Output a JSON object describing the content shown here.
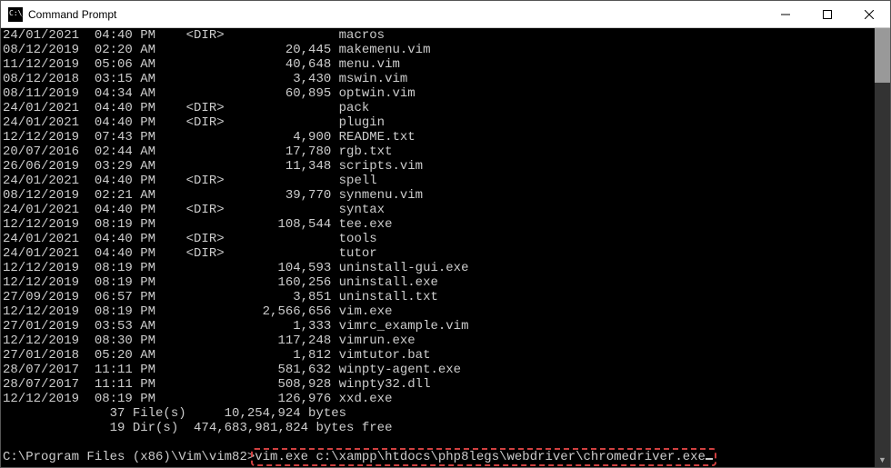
{
  "window": {
    "title": "Command Prompt"
  },
  "listing": [
    {
      "date": "24/01/2021",
      "time": "04:40 PM",
      "dir": true,
      "size": "",
      "name": "macros"
    },
    {
      "date": "08/12/2019",
      "time": "02:20 AM",
      "dir": false,
      "size": "20,445",
      "name": "makemenu.vim"
    },
    {
      "date": "11/12/2019",
      "time": "05:06 AM",
      "dir": false,
      "size": "40,648",
      "name": "menu.vim"
    },
    {
      "date": "08/12/2018",
      "time": "03:15 AM",
      "dir": false,
      "size": "3,430",
      "name": "mswin.vim"
    },
    {
      "date": "08/11/2019",
      "time": "04:34 AM",
      "dir": false,
      "size": "60,895",
      "name": "optwin.vim"
    },
    {
      "date": "24/01/2021",
      "time": "04:40 PM",
      "dir": true,
      "size": "",
      "name": "pack"
    },
    {
      "date": "24/01/2021",
      "time": "04:40 PM",
      "dir": true,
      "size": "",
      "name": "plugin"
    },
    {
      "date": "12/12/2019",
      "time": "07:43 PM",
      "dir": false,
      "size": "4,900",
      "name": "README.txt"
    },
    {
      "date": "20/07/2016",
      "time": "02:44 AM",
      "dir": false,
      "size": "17,780",
      "name": "rgb.txt"
    },
    {
      "date": "26/06/2019",
      "time": "03:29 AM",
      "dir": false,
      "size": "11,348",
      "name": "scripts.vim"
    },
    {
      "date": "24/01/2021",
      "time": "04:40 PM",
      "dir": true,
      "size": "",
      "name": "spell"
    },
    {
      "date": "08/12/2019",
      "time": "02:21 AM",
      "dir": false,
      "size": "39,770",
      "name": "synmenu.vim"
    },
    {
      "date": "24/01/2021",
      "time": "04:40 PM",
      "dir": true,
      "size": "",
      "name": "syntax"
    },
    {
      "date": "12/12/2019",
      "time": "08:19 PM",
      "dir": false,
      "size": "108,544",
      "name": "tee.exe"
    },
    {
      "date": "24/01/2021",
      "time": "04:40 PM",
      "dir": true,
      "size": "",
      "name": "tools"
    },
    {
      "date": "24/01/2021",
      "time": "04:40 PM",
      "dir": true,
      "size": "",
      "name": "tutor"
    },
    {
      "date": "12/12/2019",
      "time": "08:19 PM",
      "dir": false,
      "size": "104,593",
      "name": "uninstall-gui.exe"
    },
    {
      "date": "12/12/2019",
      "time": "08:19 PM",
      "dir": false,
      "size": "160,256",
      "name": "uninstall.exe"
    },
    {
      "date": "27/09/2019",
      "time": "06:57 PM",
      "dir": false,
      "size": "3,851",
      "name": "uninstall.txt"
    },
    {
      "date": "12/12/2019",
      "time": "08:19 PM",
      "dir": false,
      "size": "2,566,656",
      "name": "vim.exe"
    },
    {
      "date": "27/01/2019",
      "time": "03:53 AM",
      "dir": false,
      "size": "1,333",
      "name": "vimrc_example.vim"
    },
    {
      "date": "12/12/2019",
      "time": "08:30 PM",
      "dir": false,
      "size": "117,248",
      "name": "vimrun.exe"
    },
    {
      "date": "27/01/2018",
      "time": "05:20 AM",
      "dir": false,
      "size": "1,812",
      "name": "vimtutor.bat"
    },
    {
      "date": "28/07/2017",
      "time": "11:11 PM",
      "dir": false,
      "size": "581,632",
      "name": "winpty-agent.exe"
    },
    {
      "date": "28/07/2017",
      "time": "11:11 PM",
      "dir": false,
      "size": "508,928",
      "name": "winpty32.dll"
    },
    {
      "date": "12/12/2019",
      "time": "08:19 PM",
      "dir": false,
      "size": "126,976",
      "name": "xxd.exe"
    }
  ],
  "summary": {
    "files_line": "              37 File(s)     10,254,924 bytes",
    "dirs_line": "              19 Dir(s)  474,683,981,824 bytes free"
  },
  "prompt": {
    "path": "C:\\Program Files (x86)\\Vim\\vim82>",
    "command": "vim.exe c:\\xampp\\htdocs\\php8legs\\webdriver\\chromedriver.exe"
  }
}
